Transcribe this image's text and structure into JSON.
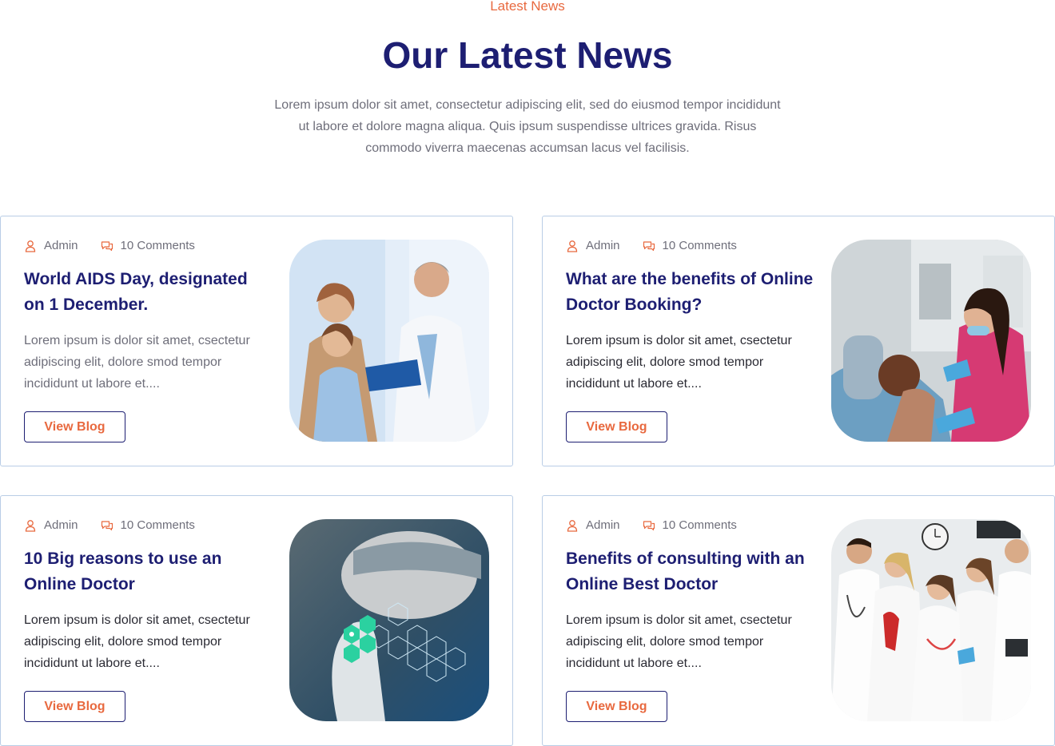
{
  "header": {
    "eyebrow": "Latest News",
    "title": "Our Latest News",
    "description": "Lorem ipsum dolor sit amet, consectetur adipiscing elit, sed do eiusmod tempor incididunt ut labore et dolore magna aliqua. Quis ipsum suspendisse ultrices gravida. Risus commodo viverra maecenas accumsan lacus vel facilisis."
  },
  "colors": {
    "accent": "#e8693f",
    "heading": "#1d1e72",
    "card_border": "#b9cde6",
    "body_text": "#6e6e7a"
  },
  "icons": {
    "author": "user-icon",
    "comments": "comments-icon"
  },
  "posts": [
    {
      "author": "Admin",
      "comments": "10 Comments",
      "title": "World AIDS Day, designated on 1 December.",
      "excerpt": "Lorem ipsum is dolor sit amet, csectetur adipiscing elit, dolore smod tempor incididunt ut labore et....",
      "button": "View Blog",
      "image": "doctor-with-mother-and-child-photo"
    },
    {
      "author": "Admin",
      "comments": "10 Comments",
      "title": "What are the benefits of Online Doctor Booking?",
      "excerpt": "Lorem ipsum is dolor sit amet, csectetur adipiscing elit, dolore smod tempor incididunt ut labore et....",
      "button": "View Blog",
      "image": "dentist-with-patient-photo"
    },
    {
      "author": "Admin",
      "comments": "10 Comments",
      "title": "10 Big reasons to use an Online Doctor",
      "excerpt": "Lorem ipsum is dolor sit amet, csectetur adipiscing elit, dolore smod tempor incididunt ut labore et....",
      "button": "View Blog",
      "image": "digital-medicine-hexagon-photo"
    },
    {
      "author": "Admin",
      "comments": "10 Comments",
      "title": "Benefits of consulting with an Online Best Doctor",
      "excerpt": "Lorem ipsum is dolor sit amet, csectetur adipiscing elit, dolore smod tempor incididunt ut labore et....",
      "button": "View Blog",
      "image": "medical-team-group-photo"
    }
  ]
}
